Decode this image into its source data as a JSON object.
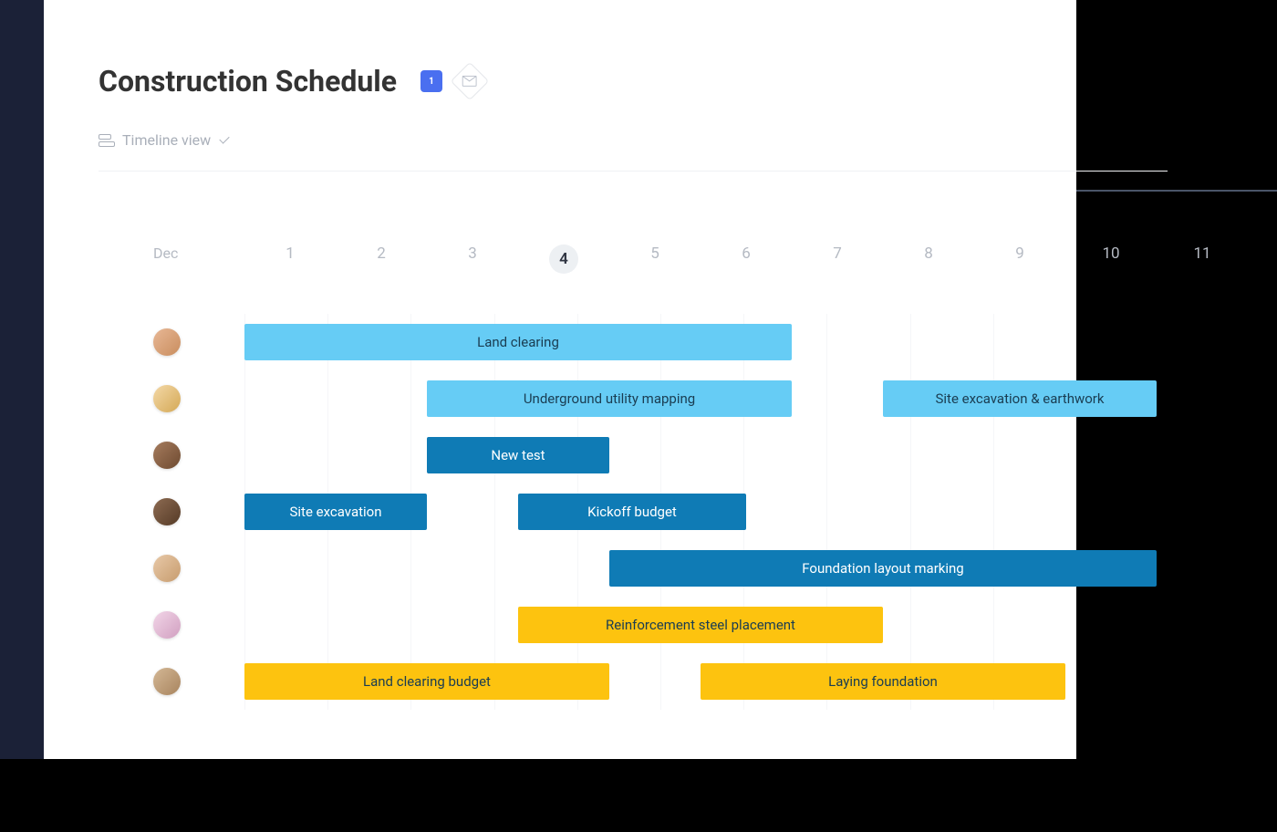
{
  "header": {
    "title": "Construction Schedule",
    "calendar_day": "1"
  },
  "view": {
    "label": "Timeline view"
  },
  "timeline": {
    "month": "Dec",
    "days": [
      "1",
      "2",
      "3",
      "4",
      "5",
      "6",
      "7",
      "8",
      "9",
      "10",
      "11"
    ],
    "current_day": "4"
  },
  "rows": [
    {
      "avatar_class": "av1",
      "bars": [
        {
          "label": "Land clearing",
          "color": "lightblue",
          "start": 1,
          "span": 6
        }
      ]
    },
    {
      "avatar_class": "av2",
      "bars": [
        {
          "label": "Underground utility mapping",
          "color": "lightblue",
          "start": 3,
          "span": 4
        },
        {
          "label": "Site excavation & earthwork",
          "color": "lightblue",
          "start": 8,
          "span": 3
        }
      ]
    },
    {
      "avatar_class": "av3",
      "bars": [
        {
          "label": "New test",
          "color": "blue",
          "start": 3,
          "span": 2
        }
      ]
    },
    {
      "avatar_class": "av4",
      "bars": [
        {
          "label": "Site excavation",
          "color": "blue",
          "start": 1,
          "span": 2
        },
        {
          "label": "Kickoff budget",
          "color": "blue",
          "start": 4,
          "span": 2.5
        }
      ]
    },
    {
      "avatar_class": "av5",
      "bars": [
        {
          "label": "Foundation layout marking",
          "color": "blue",
          "start": 5,
          "span": 6
        }
      ]
    },
    {
      "avatar_class": "av6",
      "bars": [
        {
          "label": "Reinforcement steel placement",
          "color": "yellow",
          "start": 4,
          "span": 4
        }
      ]
    },
    {
      "avatar_class": "av7",
      "bars": [
        {
          "label": "Land clearing budget",
          "color": "yellow",
          "start": 1,
          "span": 4
        },
        {
          "label": "Laying foundation",
          "color": "yellow",
          "start": 6,
          "span": 4
        }
      ]
    }
  ],
  "chart_data": {
    "type": "gantt",
    "title": "Construction Schedule",
    "x_axis": {
      "month": "Dec",
      "days": [
        1,
        2,
        3,
        4,
        5,
        6,
        7,
        8,
        9,
        10,
        11
      ],
      "current": 4
    },
    "tasks": [
      {
        "row": 0,
        "label": "Land clearing",
        "start": 1,
        "end": 7,
        "group": "lightblue"
      },
      {
        "row": 1,
        "label": "Underground utility mapping",
        "start": 3,
        "end": 7,
        "group": "lightblue"
      },
      {
        "row": 1,
        "label": "Site excavation & earthwork",
        "start": 8,
        "end": 11,
        "group": "lightblue"
      },
      {
        "row": 2,
        "label": "New test",
        "start": 3,
        "end": 5,
        "group": "blue"
      },
      {
        "row": 3,
        "label": "Site excavation",
        "start": 1,
        "end": 3,
        "group": "blue"
      },
      {
        "row": 3,
        "label": "Kickoff budget",
        "start": 4,
        "end": 6.5,
        "group": "blue"
      },
      {
        "row": 4,
        "label": "Foundation layout marking",
        "start": 5,
        "end": 11,
        "group": "blue"
      },
      {
        "row": 5,
        "label": "Reinforcement steel placement",
        "start": 4,
        "end": 8,
        "group": "yellow"
      },
      {
        "row": 6,
        "label": "Land clearing budget",
        "start": 1,
        "end": 5,
        "group": "yellow"
      },
      {
        "row": 6,
        "label": "Laying foundation",
        "start": 6,
        "end": 10,
        "group": "yellow"
      }
    ]
  }
}
